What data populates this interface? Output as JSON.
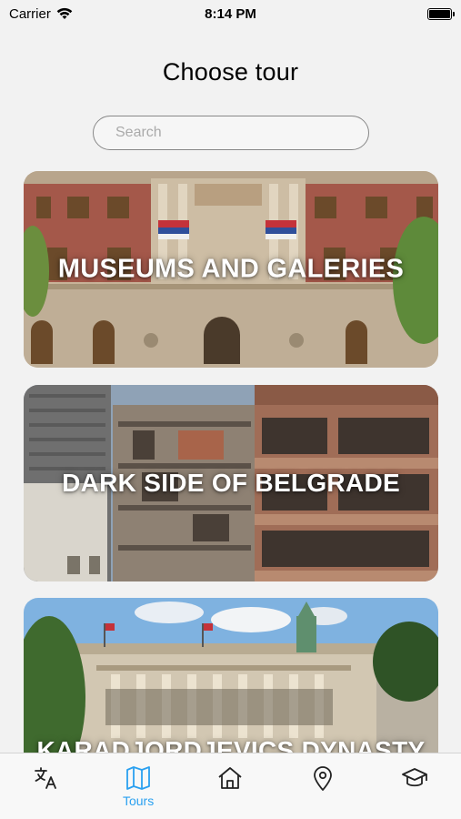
{
  "status_bar": {
    "carrier": "Carrier",
    "time": "8:14 PM"
  },
  "page": {
    "title": "Choose tour"
  },
  "search": {
    "placeholder": "Search",
    "value": ""
  },
  "tours": [
    {
      "title": "MUSEUMS AND GALERIES"
    },
    {
      "title": "DARK SIDE OF BELGRADE"
    },
    {
      "title": "KARADJORDJEVICS DYNASTY"
    }
  ],
  "tab_bar": {
    "items": [
      {
        "icon": "translate-icon",
        "label": ""
      },
      {
        "icon": "map-icon",
        "label": "Tours",
        "active": true
      },
      {
        "icon": "home-icon",
        "label": ""
      },
      {
        "icon": "location-pin-icon",
        "label": ""
      },
      {
        "icon": "graduation-cap-icon",
        "label": ""
      }
    ],
    "active_color": "#2aa0f0"
  }
}
